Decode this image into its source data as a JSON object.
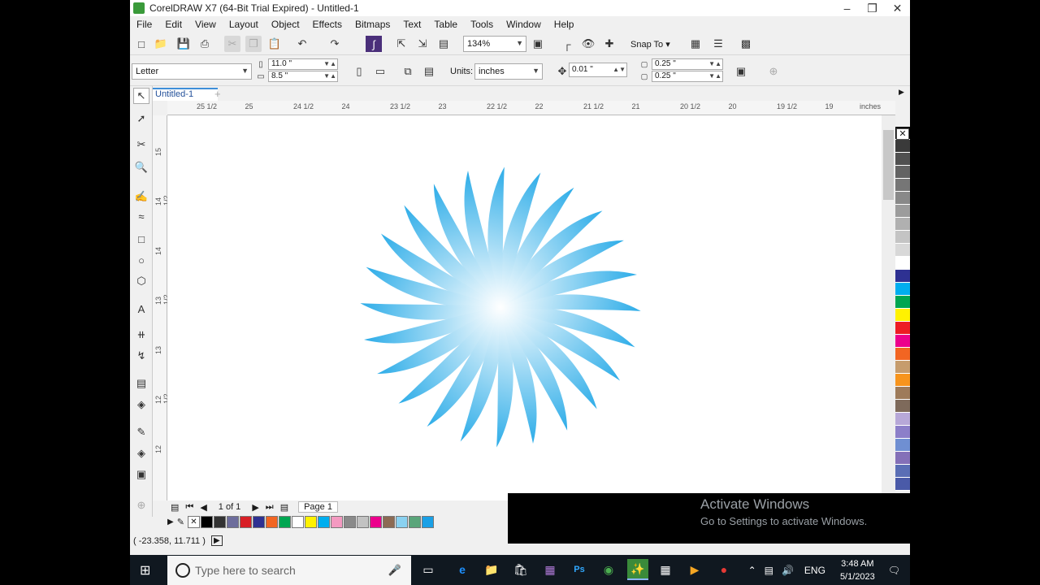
{
  "window": {
    "title": "CorelDRAW X7 (64-Bit Trial Expired) - Untitled-1"
  },
  "menu": [
    "File",
    "Edit",
    "View",
    "Layout",
    "Object",
    "Effects",
    "Bitmaps",
    "Text",
    "Table",
    "Tools",
    "Window",
    "Help"
  ],
  "toolbar": {
    "zoom": "134%",
    "snap_to": "Snap To"
  },
  "property_bar": {
    "page_size": "Letter",
    "width": "11.0 \"",
    "height": "8.5 \"",
    "units_label": "Units:",
    "units_value": "inches",
    "nudge": "0.01 \"",
    "dup_x": "0.25 \"",
    "dup_y": "0.25 \""
  },
  "document_tab": "Untitled-1",
  "ruler": {
    "top_ticks": [
      "25 1/2",
      "25",
      "24 1/2",
      "24",
      "23 1/2",
      "23",
      "22 1/2",
      "22",
      "21 1/2",
      "21",
      "20 1/2",
      "20",
      "19 1/2",
      "19"
    ],
    "left_ticks": [
      "15",
      "14 1/2",
      "14",
      "13 1/2",
      "13",
      "12 1/2",
      "12"
    ],
    "units": "inches"
  },
  "page_nav": {
    "count": "1 of 1",
    "tab": "Page 1"
  },
  "status": {
    "coords": "( -23.358, 11.711 )"
  },
  "palette": [
    "#000000",
    "#3a3a3a",
    "#505050",
    "#636363",
    "#767676",
    "#898989",
    "#9c9c9c",
    "#b0b0b0",
    "#c4c4c4",
    "#d8d8d8",
    "#ffffff",
    "#2e3192",
    "#00aeef",
    "#00a651",
    "#fff200",
    "#ed1c24",
    "#ec008c",
    "#f26522",
    "#c69c6d",
    "#f7941d",
    "#9e7b5a",
    "#7e6a5b",
    "#b7a8d8",
    "#8c7fc9",
    "#6f8fd2",
    "#8470b8",
    "#5a6eb5",
    "#4a5aa8"
  ],
  "bottom_swatches": [
    "#000000",
    "#333333",
    "#6d6d9c",
    "#d81f26",
    "#2e3192",
    "#f26522",
    "#00a651",
    "#ffffff",
    "#fff200",
    "#00aeef",
    "#f49ac1",
    "#8a8a8a",
    "#c2c2c2",
    "#ec008c",
    "#8c6b54",
    "#8ad1f0",
    "#5aa57a",
    "#1aa0e6"
  ],
  "activate": {
    "title": "Activate Windows",
    "subtitle": "Go to Settings to activate Windows."
  },
  "taskbar": {
    "search_placeholder": "Type here to search",
    "language": "ENG",
    "time": "3:48 AM",
    "date": "5/1/2023"
  },
  "artwork": {
    "petals": 24,
    "color_outer": "#1aa5e6",
    "color_inner": "#ffffff"
  }
}
